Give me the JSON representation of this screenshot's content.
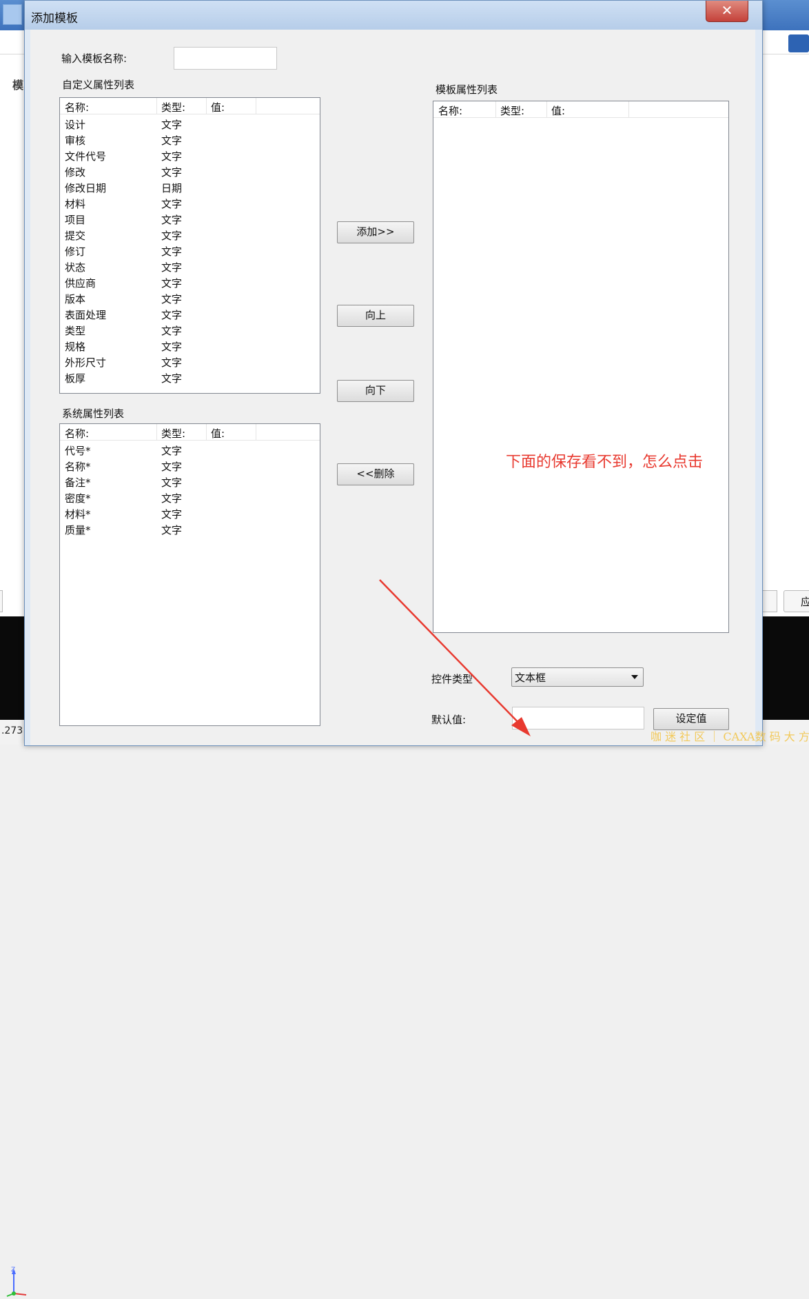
{
  "background": {
    "label_partial": "模",
    "status_number": ".273",
    "right_button_partial": "应",
    "axis_label": "Z"
  },
  "dialog": {
    "title": "添加模板",
    "close_symbol": "✕",
    "template_name_label": "输入模板名称:",
    "template_name_value": "",
    "custom_section_label": "自定义属性列表",
    "system_section_label": "系统属性列表",
    "template_section_label": "模板属性列表",
    "columns": {
      "name": "名称:",
      "type": "类型:",
      "value": "值:"
    },
    "custom_attributes": [
      {
        "name": "设计",
        "type": "文字"
      },
      {
        "name": "审核",
        "type": "文字"
      },
      {
        "name": "文件代号",
        "type": "文字"
      },
      {
        "name": "修改",
        "type": "文字"
      },
      {
        "name": "修改日期",
        "type": "日期"
      },
      {
        "name": "材料",
        "type": "文字"
      },
      {
        "name": "项目",
        "type": "文字"
      },
      {
        "name": "提交",
        "type": "文字"
      },
      {
        "name": "修订",
        "type": "文字"
      },
      {
        "name": "状态",
        "type": "文字"
      },
      {
        "name": "供应商",
        "type": "文字"
      },
      {
        "name": "版本",
        "type": "文字"
      },
      {
        "name": "表面处理",
        "type": "文字"
      },
      {
        "name": "类型",
        "type": "文字"
      },
      {
        "name": "规格",
        "type": "文字"
      },
      {
        "name": "外形尺寸",
        "type": "文字"
      },
      {
        "name": "板厚",
        "type": "文字"
      }
    ],
    "system_attributes": [
      {
        "name": "代号*",
        "type": "文字"
      },
      {
        "name": "名称*",
        "type": "文字"
      },
      {
        "name": "备注*",
        "type": "文字"
      },
      {
        "name": "密度*",
        "type": "文字"
      },
      {
        "name": "材料*",
        "type": "文字"
      },
      {
        "name": "质量*",
        "type": "文字"
      }
    ],
    "buttons": {
      "add": "添加>>",
      "up": "向上",
      "down": "向下",
      "delete": "<<删除",
      "set_value": "设定值"
    },
    "control_type_label": "控件类型",
    "control_type_value": "文本框",
    "default_value_label": "默认值:",
    "default_value": ""
  },
  "annotation": {
    "text": "下面的保存看不到，怎么点击",
    "color": "#e8392f"
  },
  "watermark": "咖 迷 社 区 ｜ CAXA数 码 大 方"
}
